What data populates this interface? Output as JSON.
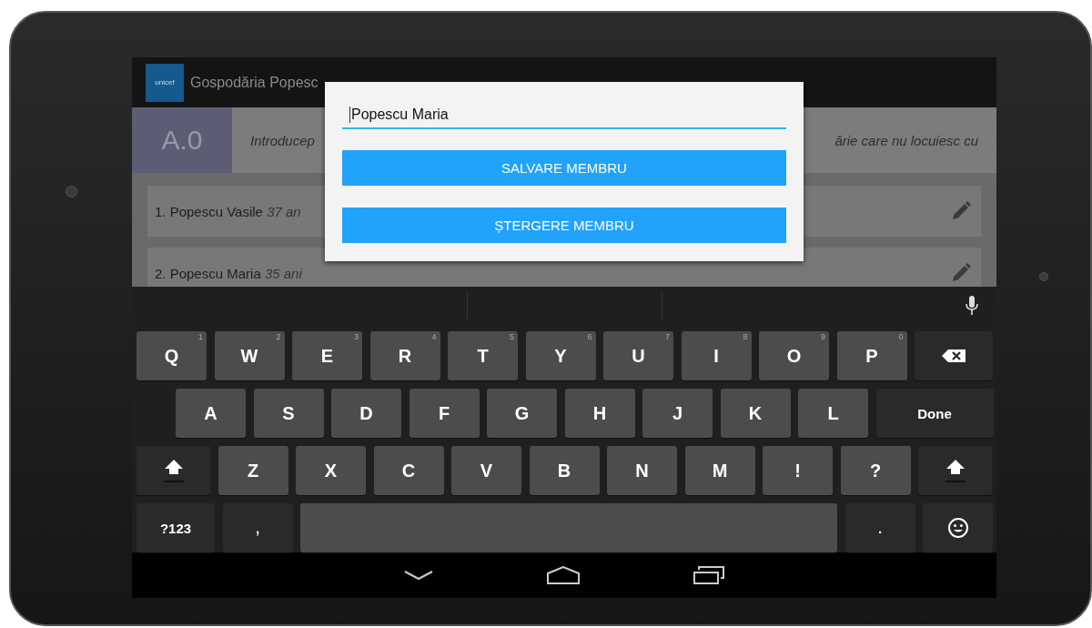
{
  "app_bar": {
    "logo_text": "unicef",
    "title": "Gospodăria Popesc"
  },
  "section": {
    "code": "A.0",
    "intro_start": "Introducep",
    "intro_end": "ărie care nu locuiesc cu"
  },
  "members": [
    {
      "name": "1. Popescu Vasile",
      "age": "37 an"
    },
    {
      "name": "2. Popescu Maria",
      "age": "35 ani"
    }
  ],
  "dialog": {
    "name_value": "Popescu Maria",
    "buttons": [
      "SALVARE MEMBRU",
      "ȘTERGERE MEMBRU"
    ]
  },
  "keyboard": {
    "rows": [
      [
        {
          "kind": "letter",
          "label": "Q",
          "hint": "1"
        },
        {
          "kind": "letter",
          "label": "W",
          "hint": "2"
        },
        {
          "kind": "letter",
          "label": "E",
          "hint": "3"
        },
        {
          "kind": "letter",
          "label": "R",
          "hint": "4"
        },
        {
          "kind": "letter",
          "label": "T",
          "hint": "5"
        },
        {
          "kind": "letter",
          "label": "Y",
          "hint": "6"
        },
        {
          "kind": "letter",
          "label": "U",
          "hint": "7"
        },
        {
          "kind": "letter",
          "label": "I",
          "hint": "8"
        },
        {
          "kind": "letter",
          "label": "O",
          "hint": "9"
        },
        {
          "kind": "letter",
          "label": "P",
          "hint": "0"
        },
        {
          "kind": "backspace"
        }
      ],
      [
        {
          "kind": "letter",
          "label": "A"
        },
        {
          "kind": "letter",
          "label": "S"
        },
        {
          "kind": "letter",
          "label": "D"
        },
        {
          "kind": "letter",
          "label": "F"
        },
        {
          "kind": "letter",
          "label": "G"
        },
        {
          "kind": "letter",
          "label": "H"
        },
        {
          "kind": "letter",
          "label": "J"
        },
        {
          "kind": "letter",
          "label": "K"
        },
        {
          "kind": "letter",
          "label": "L"
        },
        {
          "kind": "action",
          "label": "Done"
        }
      ],
      [
        {
          "kind": "shift"
        },
        {
          "kind": "letter",
          "label": "Z"
        },
        {
          "kind": "letter",
          "label": "X"
        },
        {
          "kind": "letter",
          "label": "C"
        },
        {
          "kind": "letter",
          "label": "V"
        },
        {
          "kind": "letter",
          "label": "B"
        },
        {
          "kind": "letter",
          "label": "N"
        },
        {
          "kind": "letter",
          "label": "M"
        },
        {
          "kind": "letter",
          "label": "!"
        },
        {
          "kind": "letter",
          "label": "?"
        },
        {
          "kind": "shift"
        }
      ],
      [
        {
          "kind": "action",
          "label": "?123"
        },
        {
          "kind": "action",
          "label": ","
        },
        {
          "kind": "space"
        },
        {
          "kind": "action",
          "label": "."
        },
        {
          "kind": "emoji"
        }
      ]
    ]
  }
}
